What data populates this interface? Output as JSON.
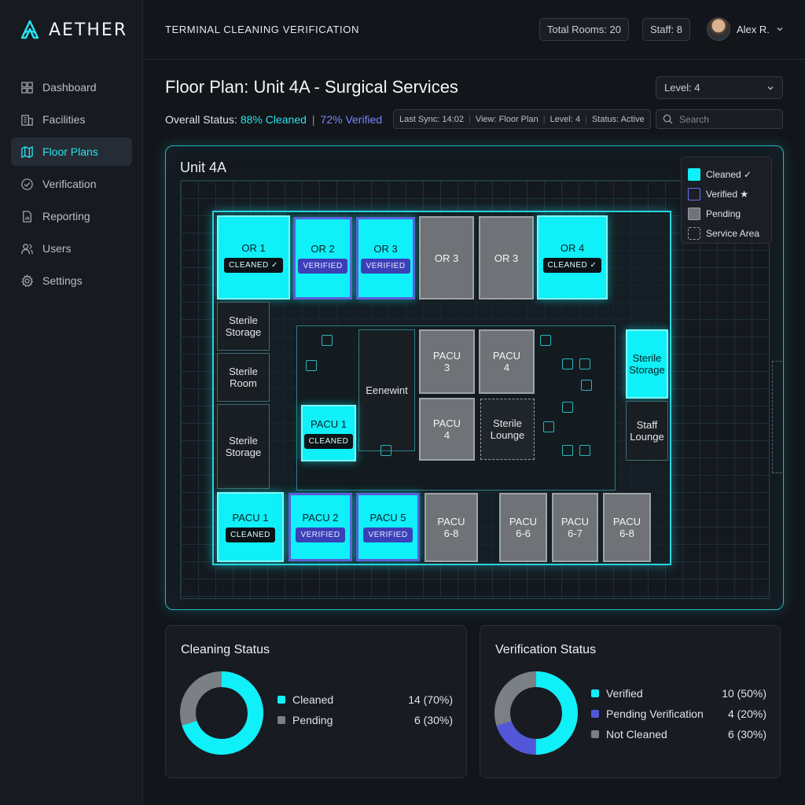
{
  "brand": {
    "name": "AETHER"
  },
  "nav": [
    {
      "label": "Dashboard",
      "icon": "dashboard-icon"
    },
    {
      "label": "Facilities",
      "icon": "building-icon"
    },
    {
      "label": "Floor Plans",
      "icon": "map-icon",
      "active": true
    },
    {
      "label": "Verification",
      "icon": "check-circle-icon"
    },
    {
      "label": "Reporting",
      "icon": "report-icon"
    },
    {
      "label": "Users",
      "icon": "users-icon"
    },
    {
      "label": "Settings",
      "icon": "gear-icon"
    }
  ],
  "header": {
    "title": "TERMINAL CLEANING VERIFICATION",
    "total_rooms": "Total Rooms: 20",
    "staff": "Staff: 8",
    "user_name": "Alex R."
  },
  "page": {
    "title": "Floor Plan: Unit 4A - Surgical Services",
    "level_select": "Level: 4",
    "status_label": "Overall Status:",
    "status_cleaned": "88% Cleaned",
    "status_verified": "72% Verified",
    "meta": {
      "last_sync": "Last Sync: 14:02",
      "view": "View: Floor Plan",
      "level": "Level: 4",
      "status": "Status: Active"
    },
    "search_placeholder": "Search"
  },
  "plan": {
    "title": "Unit 4A",
    "legend": {
      "cleaned": "Cleaned ✓",
      "verified": "Verified ★",
      "pending": "Pending",
      "service": "Service Area"
    },
    "rooms": {
      "or1": "OR 1",
      "or2": "OR 2",
      "or3a": "OR 3",
      "or3b": "OR 3",
      "or3c": "OR 3",
      "or4": "OR 4",
      "sterile_storage_1": "Sterile\nStorage",
      "sterile_room": "Sterile\nRoom",
      "sterile_storage_2": "Sterile\nStorage",
      "eenewint": "Eenewint",
      "pacu1_core": "PACU 1",
      "pacu3": "PACU\n3",
      "pacu4a": "PACU\n4",
      "pacu4b": "PACU\n4",
      "sterile_lounge": "Sterile\nLounge",
      "sterile_storage_right": "Sterile\nStorage",
      "staff_lounge": "Staff\nLounge",
      "pacu1": "PACU 1",
      "pacu2": "PACU 2",
      "pacu5": "PACU 5",
      "pacu68a": "PACU\n6-8",
      "pacu66": "PACU\n6-6",
      "pacu67": "PACU\n6-7",
      "pacu68b": "PACU\n6-8"
    },
    "tags": {
      "cleaned_check": "CLEANED ✓",
      "verified": "VERIFIED",
      "cleaned": "CLEANED"
    }
  },
  "cleaning": {
    "title": "Cleaning Status",
    "items": [
      {
        "label": "Cleaned",
        "value": "14 (70%)",
        "color": "#0ff0f8"
      },
      {
        "label": "Pending",
        "value": "6 (30%)",
        "color": "#7b8087"
      }
    ]
  },
  "verification": {
    "title": "Verification Status",
    "items": [
      {
        "label": "Verified",
        "value": "10 (50%)",
        "color": "#0ff0f8"
      },
      {
        "label": "Pending Verification",
        "value": "4 (20%)",
        "color": "#5257d8"
      },
      {
        "label": "Not Cleaned",
        "value": "6 (30%)",
        "color": "#7b8087"
      }
    ]
  },
  "colors": {
    "accent": "#0ff0f8",
    "violet": "#5b5fd8",
    "pending": "#6f7377"
  }
}
